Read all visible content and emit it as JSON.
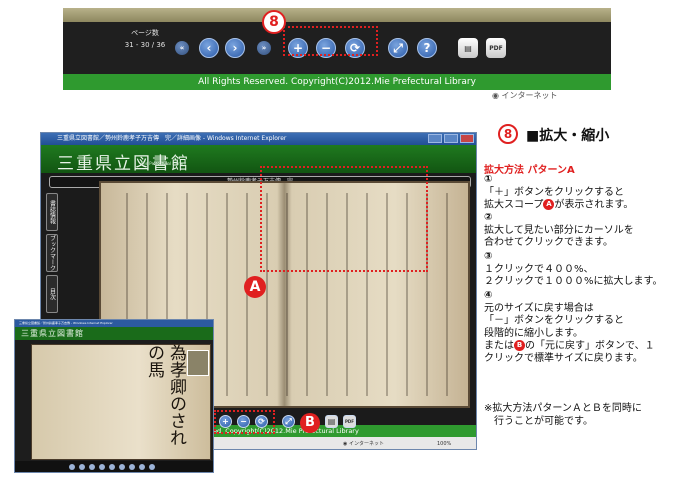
{
  "top_toolbar": {
    "page_label": "ページ数",
    "page_count": "31 - 30 / 36",
    "copyright": "All Rights Reserved. Copyright(C)2012.Mie Prefectural Library",
    "callout_number": "8",
    "status_text": "インターネット",
    "buttons": [
      {
        "name": "first-page",
        "glyph": "«"
      },
      {
        "name": "prev-page",
        "glyph": "‹"
      },
      {
        "name": "next-page",
        "glyph": "›"
      },
      {
        "name": "last-page",
        "glyph": "»"
      },
      {
        "name": "zoom-in",
        "glyph": "+"
      },
      {
        "name": "zoom-out",
        "glyph": "−"
      },
      {
        "name": "reset-size",
        "glyph": "⟳"
      },
      {
        "name": "fullscreen",
        "glyph": "⤢"
      },
      {
        "name": "help",
        "glyph": "?"
      },
      {
        "name": "print",
        "glyph": "▤"
      },
      {
        "name": "pdf",
        "glyph": "PDF"
      }
    ]
  },
  "main_window": {
    "title": "三重県立図書館／勢州鈴鹿孝子万吉傳　完／詳細画像 - Windows Internet Explorer",
    "library_name": "三重県立図書館",
    "library_sub": "Mie Prefectural Library",
    "book_title": "勢州鈴鹿孝子万吉傳　完",
    "side_tabs": [
      "書誌情報",
      "ブックマーク",
      "目次"
    ],
    "copyright": "All Rights Reserved. Copyright(C)2012.Mie Prefectural Library",
    "status_zone": "インターネット",
    "status_zoom": "100%",
    "label_A": "A",
    "label_B": "B"
  },
  "inset_window": {
    "title": "三重県立図書館／勢州鈴鹿孝子万吉傳 - Windows Internet Explorer",
    "library_name": "三重県立図書館",
    "text": "為孝卿のされの馬"
  },
  "explanation": {
    "number": "8",
    "title": "■拡大・縮小",
    "method_heading": "拡大方法 パターンA",
    "step1_num": "①",
    "step1_line1": "「＋」ボタンをクリックすると",
    "step1_line2_pre": "拡大スコープ",
    "step1_line2_badge": "A",
    "step1_line2_post": "が表示されます。",
    "step2_num": "②",
    "step2_line1": "拡大して見たい部分にカーソルを",
    "step2_line2": "合わせてクリックできます。",
    "step3_num": "③",
    "step3_line1": "１クリックで４００%、",
    "step3_line2": "２クリックで１０００%に拡大します。",
    "step4_num": "④",
    "step4_line1": "元のサイズに戻す場合は",
    "step4_line2": "「－」ボタンをクリックすると",
    "step4_line3": "段階的に縮小します。",
    "step4_line4_pre": "または",
    "step4_line4_badge": "B",
    "step4_line4_post": "の「元に戻す」ボタンで、１",
    "step4_line5": "クリックで標準サイズに戻ります。",
    "note_line1": "※拡大方法パターンＡとＢを同時に",
    "note_line2": "　行うことが可能です。"
  },
  "colors": {
    "accent_red": "#e02020",
    "library_green": "#2f9a2f",
    "button_blue": "#2a5aa8"
  }
}
